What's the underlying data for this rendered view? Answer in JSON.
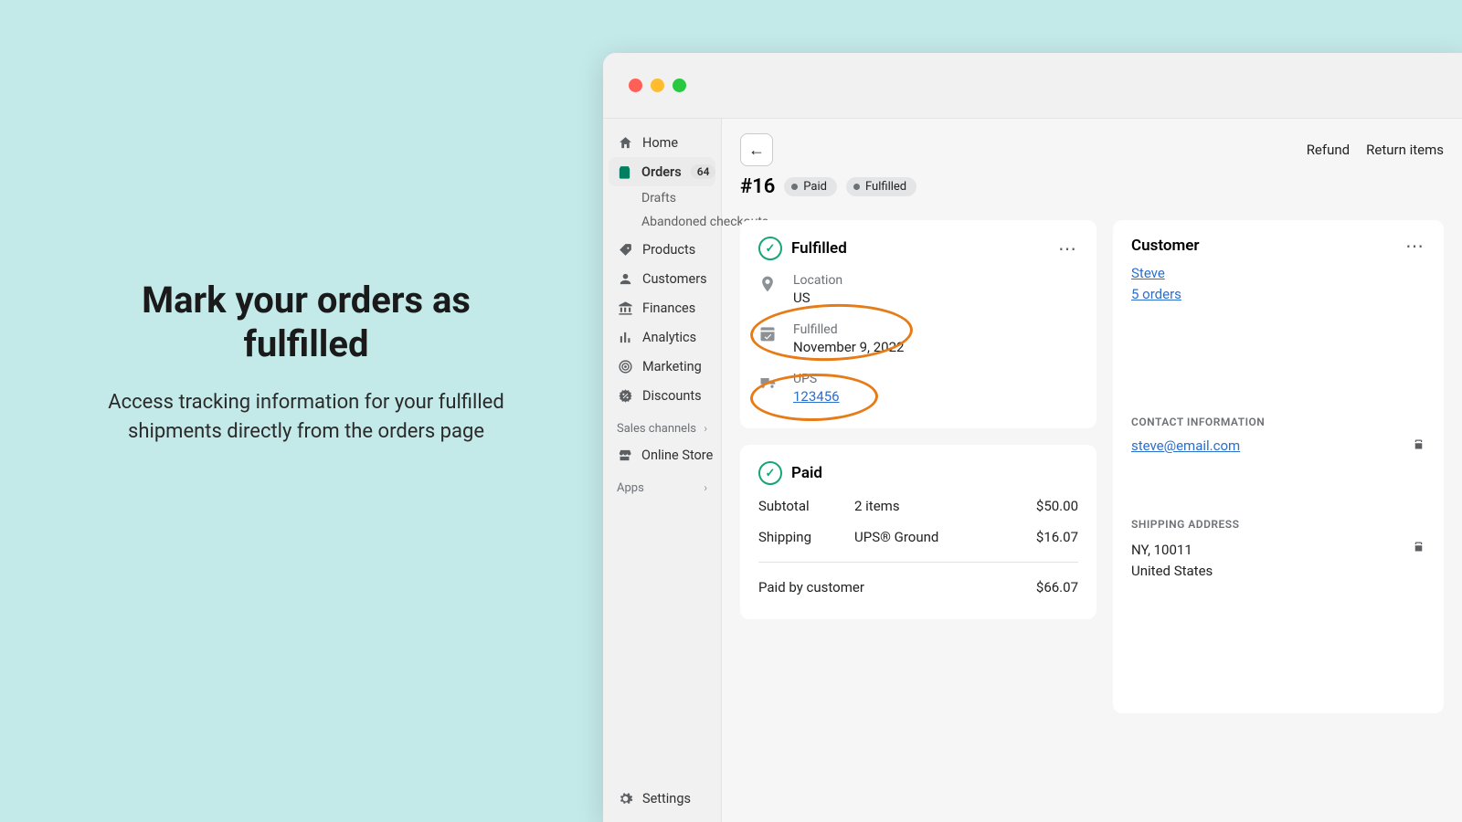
{
  "promo": {
    "title": "Mark your orders as fulfilled",
    "subtitle": "Access tracking information for your fulfilled shipments directly from the orders page"
  },
  "sidebar": {
    "home": "Home",
    "orders": "Orders",
    "orders_count": "64",
    "drafts": "Drafts",
    "abandoned": "Abandoned checkouts",
    "products": "Products",
    "customers": "Customers",
    "finances": "Finances",
    "analytics": "Analytics",
    "marketing": "Marketing",
    "discounts": "Discounts",
    "sales_channels": "Sales channels",
    "online_store": "Online Store",
    "apps": "Apps",
    "settings": "Settings"
  },
  "top": {
    "refund": "Refund",
    "return": "Return items"
  },
  "order": {
    "number": "#16",
    "paid_pill": "Paid",
    "fulfilled_pill": "Fulfilled"
  },
  "fulfilled": {
    "title": "Fulfilled",
    "location_label": "Location",
    "location_value": "US",
    "fulfilled_label": "Fulfilled",
    "fulfilled_date": "November 9, 2022",
    "carrier": "UPS",
    "tracking": "123456"
  },
  "paid": {
    "title": "Paid",
    "subtotal_label": "Subtotal",
    "subtotal_items": "2 items",
    "subtotal_amount": "$50.00",
    "shipping_label": "Shipping",
    "shipping_method": "UPS® Ground",
    "shipping_amount": "$16.07",
    "paid_label": "Paid by customer",
    "paid_amount": "$66.07"
  },
  "customer": {
    "title": "Customer",
    "name": "Steve",
    "orders": "5 orders",
    "contact_label": "CONTACT INFORMATION",
    "email": "steve@email.com",
    "shipping_label": "SHIPPING ADDRESS",
    "addr_line1": "NY, 10011",
    "addr_line2": "United States"
  }
}
